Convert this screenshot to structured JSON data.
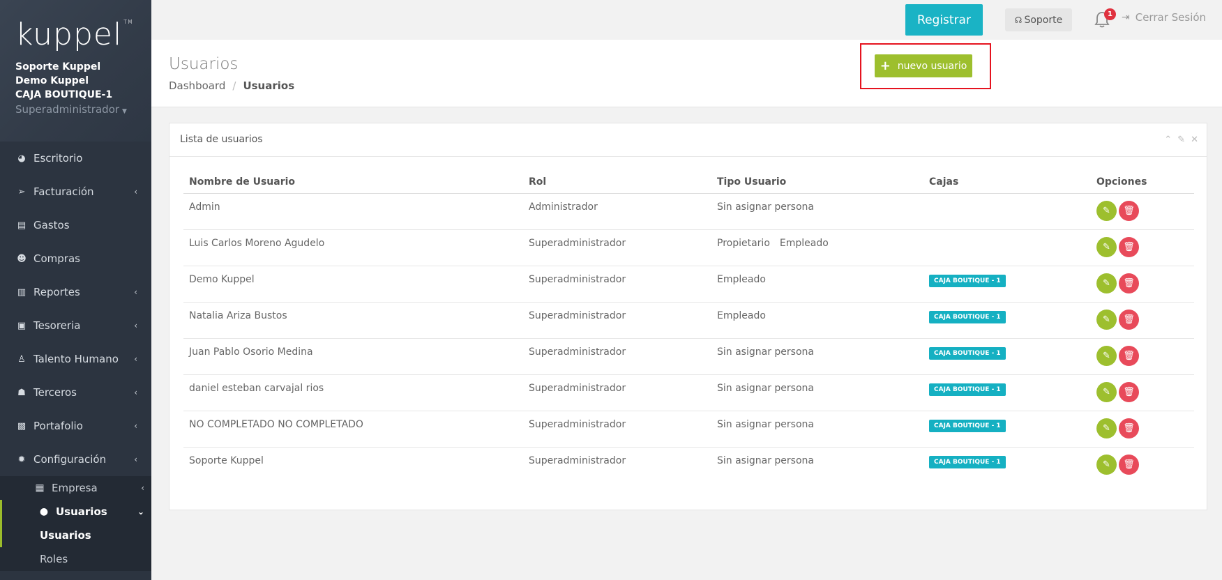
{
  "sidebar": {
    "logo": "kuppel",
    "profile": {
      "line1": "Soporte Kuppel",
      "line2": "Demo Kuppel",
      "line3": "CAJA BOUTIQUE-1",
      "role": "Superadministrador"
    },
    "items": [
      {
        "label": "Escritorio",
        "icon": "pie-chart-icon",
        "chevron": false
      },
      {
        "label": "Facturación",
        "icon": "paper-plane-icon",
        "chevron": true
      },
      {
        "label": "Gastos",
        "icon": "receipt-icon",
        "chevron": false
      },
      {
        "label": "Compras",
        "icon": "users-icon",
        "chevron": false
      },
      {
        "label": "Reportes",
        "icon": "bar-chart-icon",
        "chevron": true
      },
      {
        "label": "Tesoreria",
        "icon": "wallet-icon",
        "chevron": true
      },
      {
        "label": "Talento Humano",
        "icon": "person-icon",
        "chevron": true
      },
      {
        "label": "Terceros",
        "icon": "group-icon",
        "chevron": true
      },
      {
        "label": "Portafolio",
        "icon": "briefcase-icon",
        "chevron": true
      },
      {
        "label": "Configuración",
        "icon": "gear-icon",
        "chevron": true
      }
    ],
    "submenu": {
      "empresa": "Empresa",
      "usuarios": "Usuarios",
      "usuarios_sub": "Usuarios",
      "roles": "Roles"
    }
  },
  "topbar": {
    "registrar": "Registrar",
    "soporte": "Soporte",
    "notifications_count": "1",
    "logout": "Cerrar Sesión"
  },
  "header": {
    "title": "Usuarios",
    "breadcrumb": [
      "Dashboard",
      "Usuarios"
    ],
    "new_user": "nuevo usuario"
  },
  "card": {
    "title": "Lista de usuarios",
    "columns": [
      "Nombre de Usuario",
      "Rol",
      "Tipo Usuario",
      "Cajas",
      "Opciones"
    ],
    "rows": [
      {
        "name": "Admin",
        "role": "Administrador",
        "tipo": [
          "Sin asignar persona"
        ],
        "caja": ""
      },
      {
        "name": "Luis Carlos Moreno Agudelo",
        "role": "Superadministrador",
        "tipo": [
          "Propietario",
          "Empleado"
        ],
        "caja": ""
      },
      {
        "name": "Demo Kuppel",
        "role": "Superadministrador",
        "tipo": [
          "Empleado"
        ],
        "caja": "CAJA BOUTIQUE - 1"
      },
      {
        "name": "Natalia Ariza Bustos",
        "role": "Superadministrador",
        "tipo": [
          "Empleado"
        ],
        "caja": "CAJA BOUTIQUE - 1"
      },
      {
        "name": "Juan Pablo Osorio Medina",
        "role": "Superadministrador",
        "tipo": [
          "Sin asignar persona"
        ],
        "caja": "CAJA BOUTIQUE - 1"
      },
      {
        "name": "daniel esteban carvajal rios",
        "role": "Superadministrador",
        "tipo": [
          "Sin asignar persona"
        ],
        "caja": "CAJA BOUTIQUE - 1"
      },
      {
        "name": "NO COMPLETADO NO COMPLETADO",
        "role": "Superadministrador",
        "tipo": [
          "Sin asignar persona"
        ],
        "caja": "CAJA BOUTIQUE - 1"
      },
      {
        "name": "Soporte Kuppel",
        "role": "Superadministrador",
        "tipo": [
          "Sin asignar persona"
        ],
        "caja": "CAJA BOUTIQUE - 1"
      }
    ]
  },
  "colors": {
    "sidebar_bg": "#2c3440",
    "accent_teal": "#1ab3c5",
    "accent_green": "#9dbf2e",
    "delete_red": "#e84a5a",
    "highlight_red": "#e5131f"
  }
}
